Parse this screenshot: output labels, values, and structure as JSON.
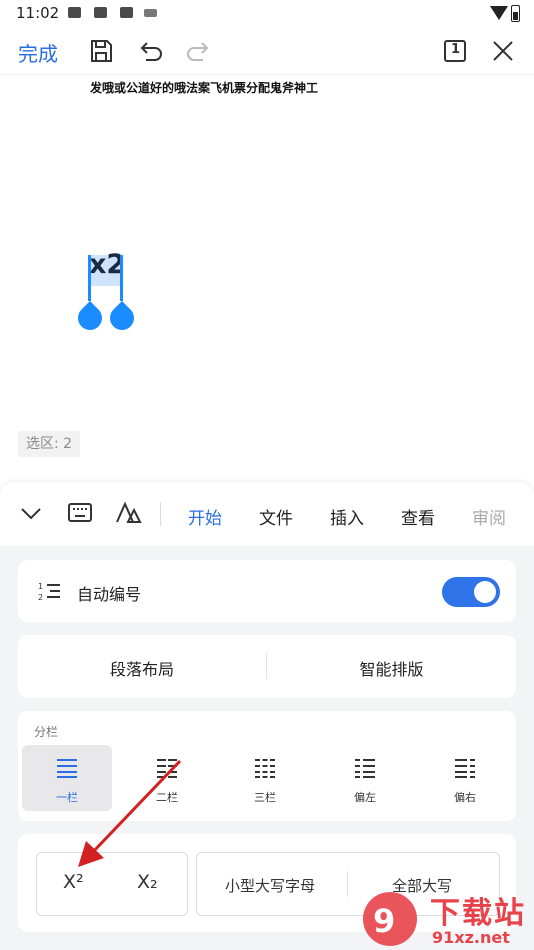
{
  "status_bar": {
    "time": "11:02"
  },
  "toolbar": {
    "done_label": "完成",
    "page_indicator": "1"
  },
  "document": {
    "text_line": "发哦或公道好的哦法案飞机票分配鬼斧神工",
    "selected_text": "x2",
    "selection_count": "选区: 2"
  },
  "panel": {
    "tabs": [
      "开始",
      "文件",
      "插入",
      "查看",
      "审阅"
    ],
    "auto_numbering": {
      "label": "自动编号",
      "enabled": true
    },
    "layout_buttons": {
      "paragraph_layout": "段落布局",
      "smart_typeset": "智能排版"
    },
    "columns": {
      "title": "分栏",
      "options": [
        "一栏",
        "二栏",
        "三栏",
        "偏左",
        "偏右"
      ],
      "selected": "一栏"
    },
    "case": {
      "superscript": "X²",
      "subscript": "X₂",
      "small_caps": "小型大写字母",
      "all_caps": "全部大写"
    }
  },
  "watermark": {
    "text": "下载站",
    "url_text": "91xz.net"
  },
  "colors": {
    "accent": "#2a6ee6",
    "selection_handle": "#1a8cff",
    "arrow": "#d32020"
  }
}
